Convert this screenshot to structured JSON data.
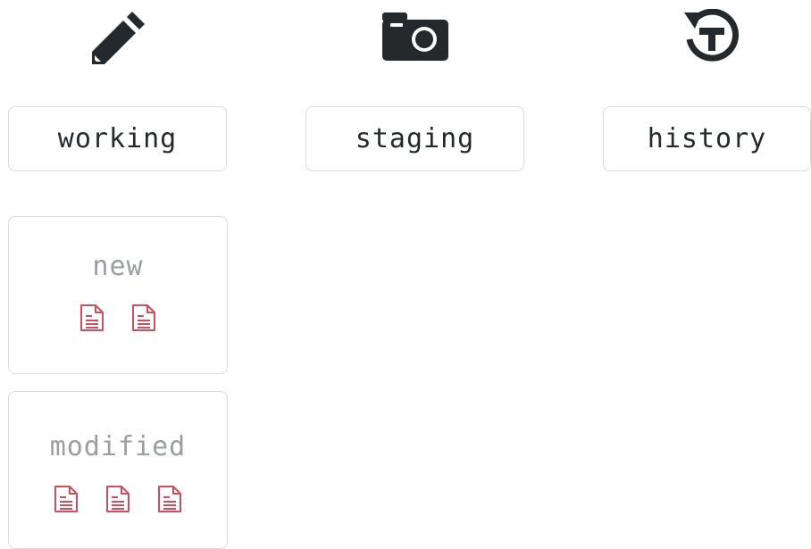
{
  "icons": {
    "working": "pencil-icon",
    "staging": "camera-icon",
    "history": "history-icon",
    "file": "file-text-icon"
  },
  "colors": {
    "icon": "#24292e",
    "file": "#cb4f5d",
    "border": "#dcdcdc",
    "muted_text": "#9a9ea4"
  },
  "stages": [
    {
      "label": "working"
    },
    {
      "label": "staging"
    },
    {
      "label": "history"
    }
  ],
  "working_groups": [
    {
      "title": "new",
      "file_count": 2
    },
    {
      "title": "modified",
      "file_count": 3
    }
  ]
}
